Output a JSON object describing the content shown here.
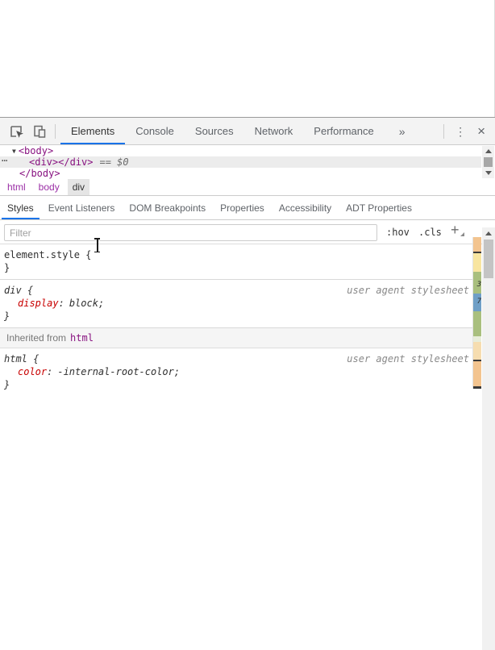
{
  "devtools": {
    "main_tabs": {
      "items": [
        "Elements",
        "Console",
        "Sources",
        "Network",
        "Performance"
      ],
      "active": "Elements"
    },
    "icons": {
      "more_tabs": "»",
      "menu": "⋮",
      "close": "×",
      "dom_gutter": "⋯",
      "disclosure": "▼"
    },
    "dom_tree": {
      "rows": [
        {
          "code": "<body>"
        },
        {
          "code": "<div></div>",
          "annotation": "== $0"
        },
        {
          "code": "</body>"
        }
      ]
    },
    "breadcrumbs": {
      "items": [
        "html",
        "body",
        "div"
      ],
      "selected": "div"
    },
    "sidebar_tabs": {
      "items": [
        "Styles",
        "Event Listeners",
        "DOM Breakpoints",
        "Properties",
        "Accessibility",
        "ADT Properties"
      ],
      "active": "Styles"
    },
    "filter": {
      "placeholder": "Filter"
    },
    "style_toggles": {
      "hov": ":hov",
      "cls": ".cls",
      "add": "+"
    },
    "styles": {
      "punct": {
        "open": "{",
        "close": "}",
        "colon": ":",
        "semicolon": ";"
      },
      "rules": [
        {
          "selector": "element.style",
          "origin": "",
          "props": []
        },
        {
          "selector": "div",
          "origin": "user agent stylesheet",
          "props": [
            {
              "name": "display",
              "value": "block"
            }
          ]
        },
        {
          "selector": "html",
          "origin": "user agent stylesheet",
          "props": [
            {
              "name": "color",
              "value": "-internal-root-color"
            }
          ]
        }
      ],
      "inherited": {
        "prefix": "Inherited from",
        "tag": "html"
      }
    },
    "colors": {
      "accent_blue": "#1a73e8",
      "tag_purple": "#881280",
      "crumb_purple": "#9b2fa6",
      "property_red": "#c80000",
      "selection_gray": "#ececec"
    },
    "scroll_strip": {
      "segments": [
        "#f3c48f",
        "#3a3a3a",
        "#f8e5a0",
        "#a9bf7e",
        "#6f9fc6",
        "#a9bf7e",
        "#e8edda",
        "#f6ddb0",
        "#3a3a3a",
        "#f3c48f",
        "#3a3a3a"
      ],
      "labels": [
        "3",
        "7"
      ]
    }
  }
}
